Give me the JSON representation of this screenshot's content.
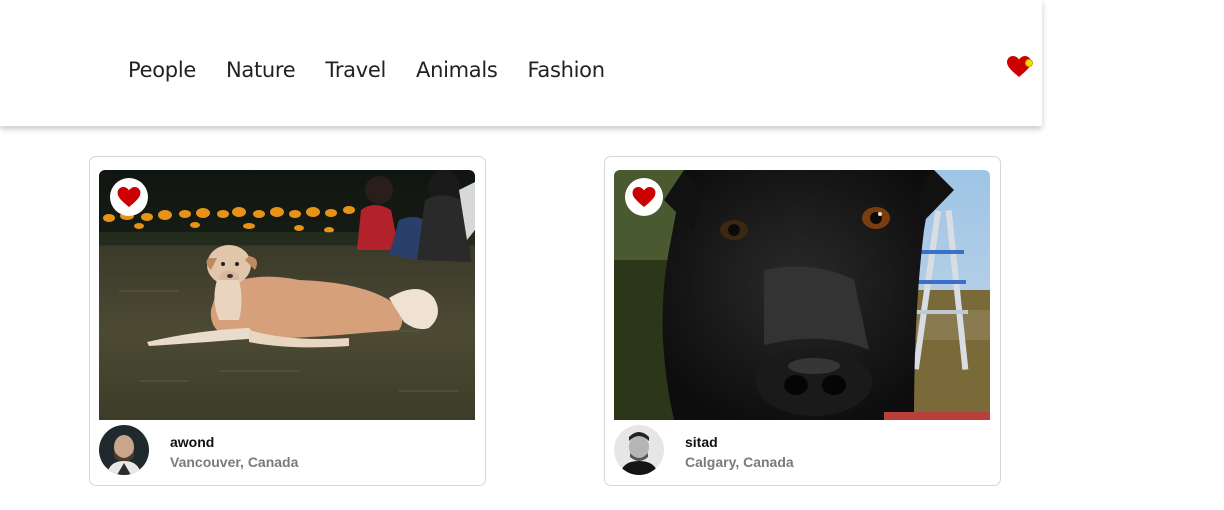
{
  "nav": {
    "items": [
      "People",
      "Nature",
      "Travel",
      "Animals",
      "Fashion"
    ],
    "favorites_icon": "heart-icon",
    "favorites_badge_color": "#f7e000"
  },
  "colors": {
    "heart": "#cc0000",
    "location_text": "#7a7a7a"
  },
  "cards": [
    {
      "username": "awond",
      "location": "Vancouver, Canada",
      "photo_subject": "dog-lying-on-grass",
      "liked": true
    },
    {
      "username": "sitad",
      "location": "Calgary, Canada",
      "photo_subject": "black-dog-closeup",
      "liked": true
    }
  ]
}
